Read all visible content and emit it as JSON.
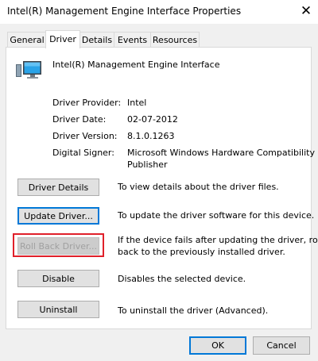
{
  "window": {
    "title": "Intel(R) Management Engine Interface  Properties",
    "close_glyph": "✕"
  },
  "tabs": [
    {
      "label": "General",
      "active": false
    },
    {
      "label": "Driver",
      "active": true
    },
    {
      "label": "Details",
      "active": false
    },
    {
      "label": "Events",
      "active": false
    },
    {
      "label": "Resources",
      "active": false
    }
  ],
  "device": {
    "name": "Intel(R) Management Engine Interface",
    "icon": "computer-monitor-icon"
  },
  "info": {
    "provider_label": "Driver Provider:",
    "provider_value": "Intel",
    "date_label": "Driver Date:",
    "date_value": "02-07-2012",
    "version_label": "Driver Version:",
    "version_value": "8.1.0.1263",
    "signer_label": "Digital Signer:",
    "signer_value_line1": "Microsoft Windows Hardware Compatibility",
    "signer_value_line2": "Publisher"
  },
  "actions": {
    "details_label": "Driver Details",
    "details_desc": "To view details about the driver files.",
    "update_label": "Update Driver...",
    "update_desc": "To update the driver software for this device.",
    "rollback_label": "Roll Back Driver...",
    "rollback_desc_line1": "If the device fails after updating the driver, roll",
    "rollback_desc_line2": "back to the previously installed driver.",
    "disable_label": "Disable",
    "disable_desc": "Disables the selected device.",
    "uninstall_label": "Uninstall",
    "uninstall_desc": "To uninstall the driver (Advanced)."
  },
  "footer": {
    "ok_label": "OK",
    "cancel_label": "Cancel"
  },
  "colors": {
    "highlight_border": "#e0202a",
    "focus_border": "#0078d7"
  }
}
